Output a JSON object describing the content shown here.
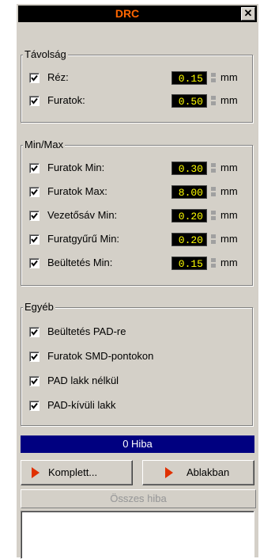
{
  "window": {
    "title": "DRC",
    "close_label": "✕"
  },
  "tavolsag": {
    "title": "Távolság",
    "rows": [
      {
        "label": "Réz:",
        "value": "0.15",
        "unit": "mm",
        "checked": true
      },
      {
        "label": "Furatok:",
        "value": "0.50",
        "unit": "mm",
        "checked": true
      }
    ]
  },
  "minmax": {
    "title": "Min/Max",
    "rows": [
      {
        "label": "Furatok Min:",
        "value": "0.30",
        "unit": "mm",
        "checked": true
      },
      {
        "label": "Furatok Max:",
        "value": "8.00",
        "unit": "mm",
        "checked": true
      },
      {
        "label": "Vezetősáv Min:",
        "value": "0.20",
        "unit": "mm",
        "checked": true
      },
      {
        "label": "Furatgyűrű Min:",
        "value": "0.20",
        "unit": "mm",
        "checked": true
      },
      {
        "label": "Beültetés Min:",
        "value": "0.15",
        "unit": "mm",
        "checked": true
      }
    ]
  },
  "egyeb": {
    "title": "Egyéb",
    "rows": [
      {
        "label": "Beültetés PAD-re",
        "checked": true
      },
      {
        "label": "Furatok SMD-pontokon",
        "checked": true
      },
      {
        "label": "PAD lakk nélkül",
        "checked": true
      },
      {
        "label": "PAD-kívüli lakk",
        "checked": true
      }
    ]
  },
  "status": {
    "text": "0 Hiba"
  },
  "buttons": {
    "komplett": "Komplett...",
    "ablakban": "Ablakban",
    "osszes_hiba": "Összes hiba"
  },
  "colors": {
    "title_text": "#ff6600",
    "value_bg": "#000000",
    "value_text": "#ffff00",
    "status_bg": "#000080",
    "arrow": "#e03000"
  }
}
